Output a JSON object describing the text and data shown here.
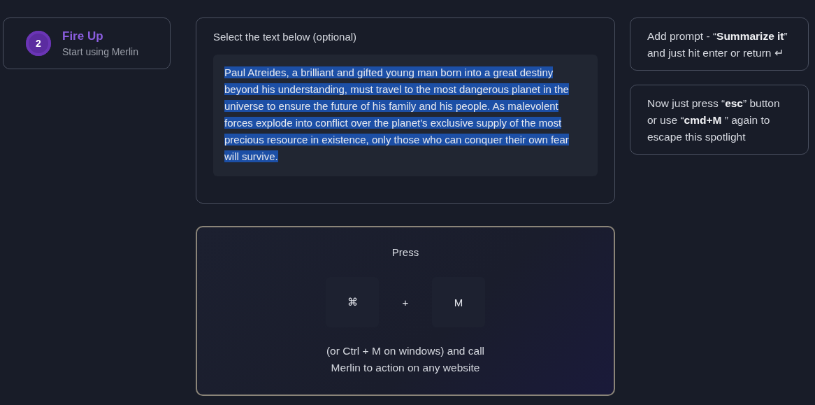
{
  "step": {
    "number": "2",
    "title": "Fire Up",
    "subtitle": "Start using Merlin"
  },
  "selection_card": {
    "heading": "Select the text below (optional)",
    "text": "Paul Atreides, a brilliant and gifted young man born into a great destiny beyond his understanding, must travel to the most dangerous planet in the universe to ensure the future of his family and his people. As malevolent forces explode into conflict over the planet's exclusive supply of the most precious resource in existence, only those who can conquer their own fear will survive.",
    "selected": true
  },
  "shortcut_card": {
    "heading": "Press",
    "keys": [
      "⌘",
      "+",
      "M"
    ],
    "caption": "(or Ctrl + M on windows) and call Merlin to action on any website"
  },
  "tips": [
    {
      "text": "Add prompt - “**Summarize it**” and just hit enter or return ↵"
    },
    {
      "text": "Now just press “**esc**” button or use “**cmd+M** ” again to escape this spotlight"
    }
  ]
}
